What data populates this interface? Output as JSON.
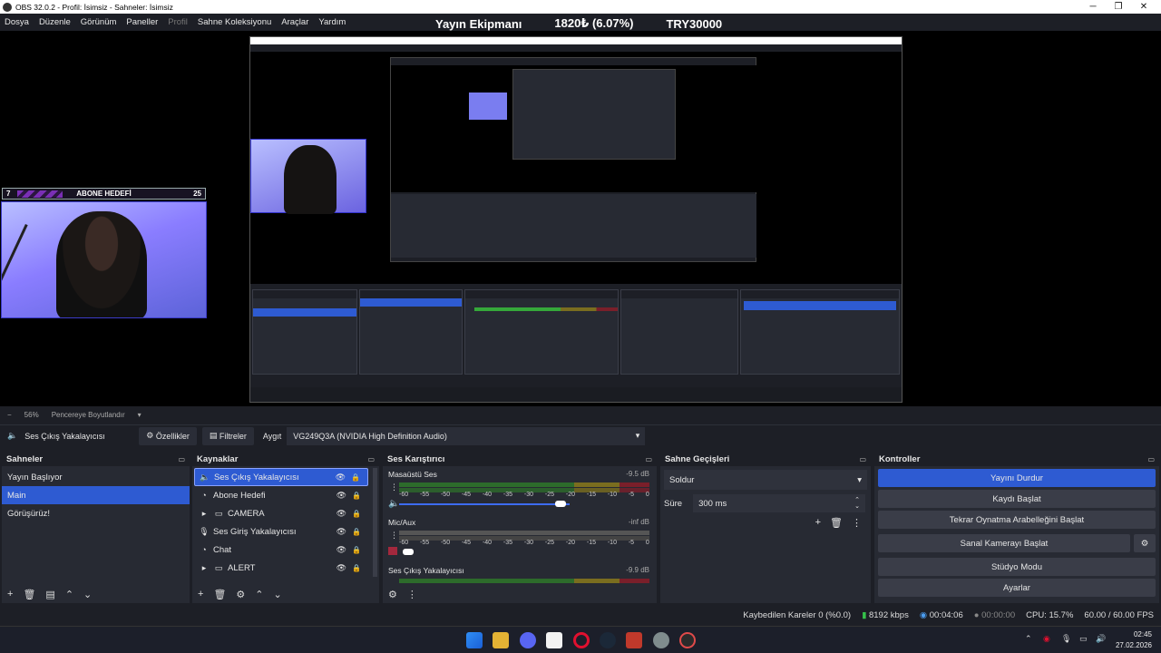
{
  "window": {
    "title": "OBS 32.0.2 - Profil: İsimsiz - Sahneler: İsimsiz",
    "min": "─",
    "max": "❐",
    "close": "✕"
  },
  "menu": [
    "Dosya",
    "Düzenle",
    "Görünüm",
    "Paneller",
    "Profil",
    "Sahne Koleksiyonu",
    "Araçlar",
    "Yardım"
  ],
  "ticker": {
    "label": "Yayın Ekipmanı",
    "value": "1820₺ (6.07%)",
    "target": "TRY30000"
  },
  "goal": {
    "left": "7",
    "label": "ABONE HEDEFİ",
    "right": "25"
  },
  "zoom": {
    "value": "56%",
    "mode": "Pencereye Boyutlandır"
  },
  "source_bar": {
    "source": "Ses Çıkış Yakalayıcısı",
    "props": "Özellikler",
    "filters": "Filtreler",
    "device_label": "Aygıt",
    "device": "VG249Q3A (NVIDIA High Definition Audio)"
  },
  "scenes": {
    "title": "Sahneler",
    "items": [
      "Yayın Başlıyor",
      "Main",
      "Görüşürüz!"
    ]
  },
  "sources": {
    "title": "Kaynaklar",
    "items": [
      {
        "label": "Ses Çıkış Yakalayıcısı",
        "icon": "speaker-icon"
      },
      {
        "label": "Abone Hedefi",
        "icon": "globe-icon"
      },
      {
        "label": "CAMERA",
        "icon": "folder-icon"
      },
      {
        "label": "Ses Giriş Yakalayıcısı",
        "icon": "mic-icon"
      },
      {
        "label": "Chat",
        "icon": "globe-icon"
      },
      {
        "label": "ALERT",
        "icon": "folder-icon"
      }
    ]
  },
  "mixer": {
    "title": "Ses Karıştırıcı",
    "channels": [
      {
        "name": "Masaüstü Ses",
        "db": "-9.5 dB"
      },
      {
        "name": "Mic/Aux",
        "db": "-inf dB"
      },
      {
        "name": "Ses Çıkış Yakalayıcısı",
        "db": "-9.9 dB"
      }
    ],
    "scale": [
      "-60",
      "-55",
      "-50",
      "-45",
      "-40",
      "-35",
      "-30",
      "-25",
      "-20",
      "-15",
      "-10",
      "-5",
      "0"
    ]
  },
  "transitions": {
    "title": "Sahne Geçişleri",
    "selected": "Soldur",
    "duration_label": "Süre",
    "duration": "300 ms"
  },
  "controls": {
    "title": "Kontroller",
    "buttons": [
      "Yayını Durdur",
      "Kaydı Başlat",
      "Tekrar Oynatma Arabelleğini Başlat",
      "Sanal Kamerayı Başlat",
      "Stüdyo Modu",
      "Ayarlar"
    ]
  },
  "status": {
    "dropped": "Kaybedilen Kareler 0 (%0.0)",
    "bitrate": "8192 kbps",
    "stream_time": "00:04:06",
    "rec_time": "00:00:00",
    "cpu": "CPU: 15.7%",
    "fps": "60.00 / 60.00 FPS"
  },
  "clock": {
    "time": "02:45",
    "date": "27.02.2026"
  },
  "colors": {
    "accent": "#2e5bd2",
    "panel": "#272a33",
    "bg": "#1d1f26"
  }
}
